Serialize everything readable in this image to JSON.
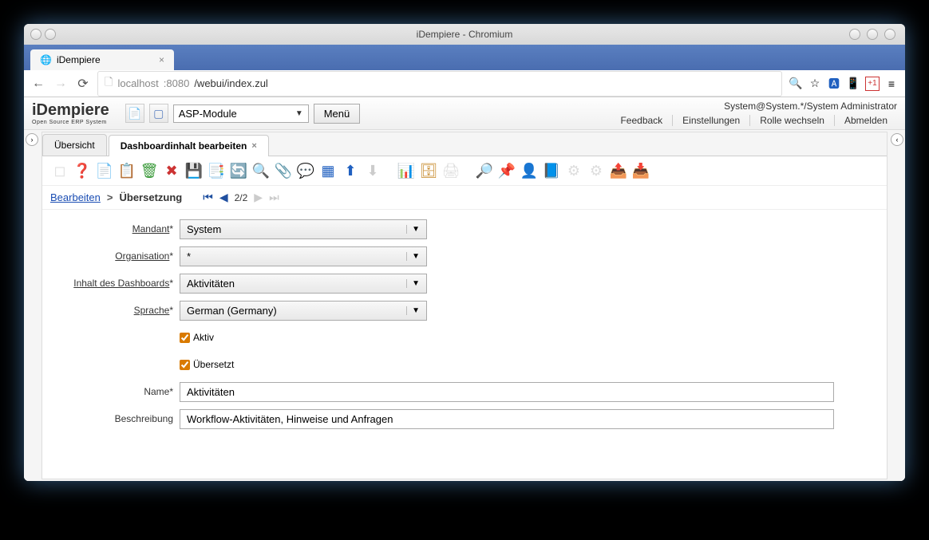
{
  "window": {
    "title": "iDempiere - Chromium"
  },
  "browser": {
    "tab_title": "iDempiere",
    "url_host": "localhost",
    "url_port": ":8080",
    "url_path": "/webui/index.zul"
  },
  "header": {
    "logo": "iDempiere",
    "logo_sub": "Open Source ERP System",
    "search_value": "ASP-Module",
    "menu_btn": "Menü",
    "user_info": "System@System.*/System Administrator",
    "links": {
      "feedback": "Feedback",
      "settings": "Einstellungen",
      "role": "Rolle wechseln",
      "logout": "Abmelden"
    }
  },
  "tabs": {
    "overview": "Übersicht",
    "edit_dashboard": "Dashboardinhalt bearbeiten"
  },
  "breadcrumb": {
    "edit": "Bearbeiten",
    "sep": ">",
    "translation": "Übersetzung",
    "pager": "2/2"
  },
  "form": {
    "labels": {
      "mandant": "Mandant",
      "organisation": "Organisation",
      "dashboard_content": "Inhalt des Dashboards",
      "sprache": "Sprache",
      "aktiv": "Aktiv",
      "uebersetzt": "Übersetzt",
      "name": "Name",
      "beschreibung": "Beschreibung"
    },
    "values": {
      "mandant": "System",
      "organisation": "*",
      "dashboard_content": "Aktivitäten",
      "sprache": "German (Germany)",
      "aktiv_checked": true,
      "uebersetzt_checked": true,
      "name": "Aktivitäten",
      "beschreibung": "Workflow-Aktivitäten, Hinweise und Anfragen"
    }
  }
}
